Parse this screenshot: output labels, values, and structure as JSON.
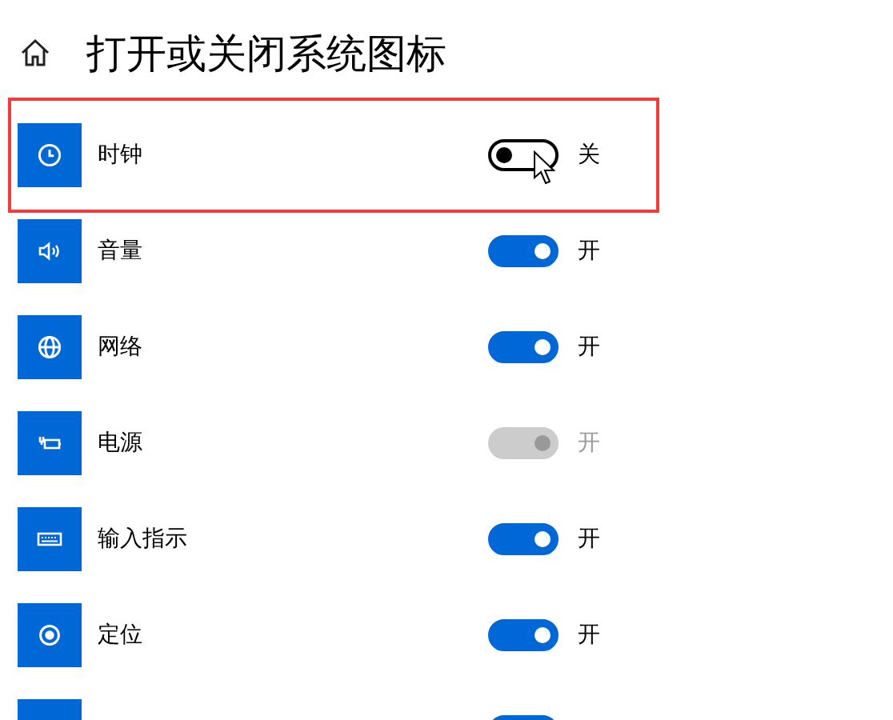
{
  "header": {
    "title": "打开或关闭系统图标"
  },
  "items": [
    {
      "kind": "clock",
      "label": "时钟",
      "on": false,
      "disabled": false,
      "state_text": "关",
      "highlighted": true,
      "pointer_over": true
    },
    {
      "kind": "speaker",
      "label": "音量",
      "on": true,
      "disabled": false,
      "state_text": "开",
      "highlighted": false,
      "pointer_over": false
    },
    {
      "kind": "globe",
      "label": "网络",
      "on": true,
      "disabled": false,
      "state_text": "开",
      "highlighted": false,
      "pointer_over": false
    },
    {
      "kind": "power",
      "label": "电源",
      "on": true,
      "disabled": true,
      "state_text": "开",
      "highlighted": false,
      "pointer_over": false
    },
    {
      "kind": "keyboard",
      "label": "输入指示",
      "on": true,
      "disabled": false,
      "state_text": "开",
      "highlighted": false,
      "pointer_over": false
    },
    {
      "kind": "location",
      "label": "定位",
      "on": true,
      "disabled": false,
      "state_text": "开",
      "highlighted": false,
      "pointer_over": false
    },
    {
      "kind": "blank",
      "on": true,
      "disabled": false,
      "highlighted": false,
      "pointer_over": false
    }
  ]
}
